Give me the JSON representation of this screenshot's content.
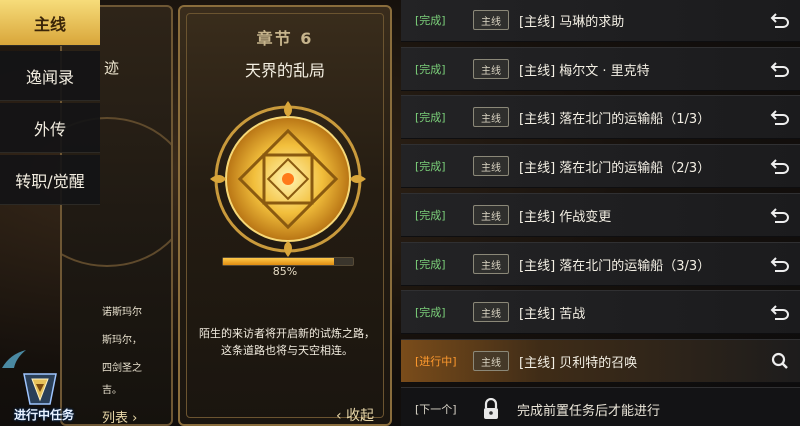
{
  "tabs": [
    {
      "label": "主线",
      "active": true
    },
    {
      "label": "逸闻录",
      "active": false
    },
    {
      "label": "外传",
      "active": false
    },
    {
      "label": "转职/觉醒",
      "active": false
    }
  ],
  "prev_card": {
    "title_fragment": "迹",
    "lines": [
      "诺斯玛尔",
      "斯玛尔，",
      "四剑圣之",
      "吉。"
    ],
    "list_link": "列表"
  },
  "chapter_card": {
    "chapter": "章节 6",
    "title": "天界的乱局",
    "progress_value": 0.85,
    "progress_text": "85%",
    "description": "陌生的来访者将开启新的试炼之路，这条道路也将与天空相连。",
    "collapse_label": "收起"
  },
  "quests": [
    {
      "status": "[完成]",
      "type": "主线",
      "name": "[主线] 马琳的求助",
      "icon": "return-icon"
    },
    {
      "status": "[完成]",
      "type": "主线",
      "name": "[主线] 梅尔文 · 里克特",
      "icon": "return-icon"
    },
    {
      "status": "[完成]",
      "type": "主线",
      "name": "[主线] 落在北门的运输船（1/3）",
      "icon": "return-icon"
    },
    {
      "status": "[完成]",
      "type": "主线",
      "name": "[主线] 落在北门的运输船（2/3）",
      "icon": "return-icon"
    },
    {
      "status": "[完成]",
      "type": "主线",
      "name": "[主线] 作战变更",
      "icon": "return-icon"
    },
    {
      "status": "[完成]",
      "type": "主线",
      "name": "[主线] 落在北门的运输船（3/3）",
      "icon": "return-icon"
    },
    {
      "status": "[完成]",
      "type": "主线",
      "name": "[主线] 苦战",
      "icon": "return-icon"
    },
    {
      "status": "[进行中]",
      "type": "主线",
      "name": "[主线] 贝利特的召唤",
      "icon": "search-icon"
    }
  ],
  "next_quest": {
    "status": "[下一个]",
    "text": "完成前置任务后才能进行",
    "icon": "lock-icon"
  },
  "ongoing_badge": {
    "label": "进行中任务"
  },
  "colors": {
    "gold": "#e0a83a",
    "complete": "#7bd07a",
    "in_progress": "#ff9a2e"
  }
}
